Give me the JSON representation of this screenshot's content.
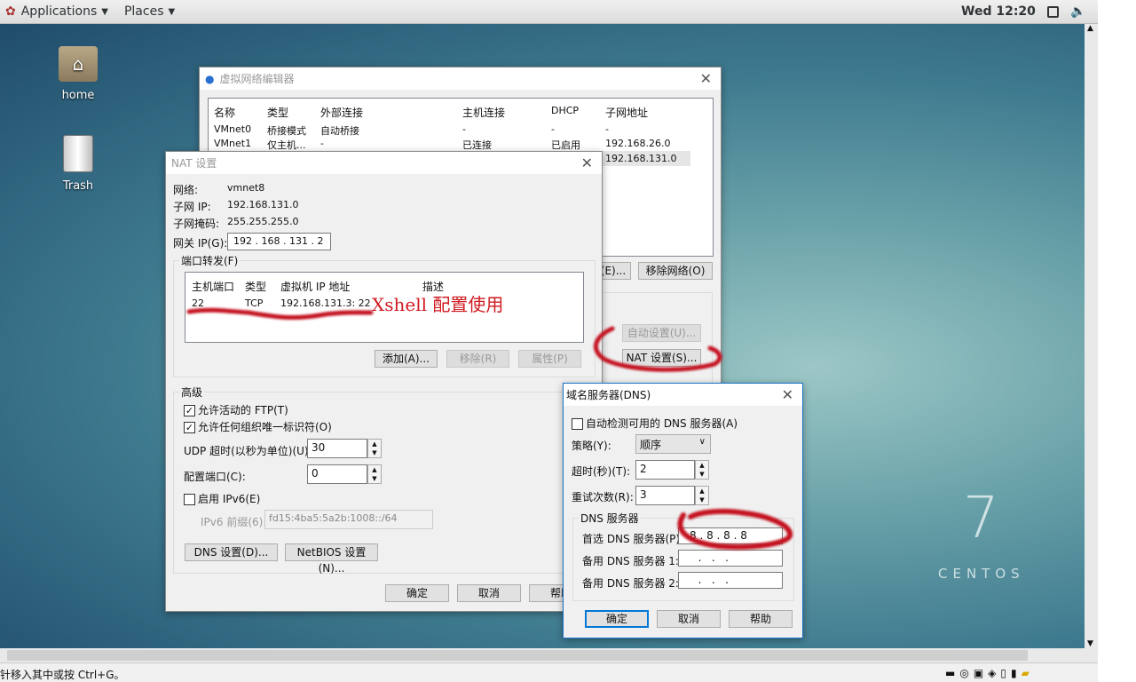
{
  "topbar": {
    "applications": "Applications",
    "places": "Places",
    "clock": "Wed 12:20"
  },
  "desktop": {
    "icons": [
      {
        "label": "home"
      },
      {
        "label": "Trash"
      }
    ],
    "brand_number": "7",
    "brand_text": "CENTOS"
  },
  "status_bar": {
    "text": "针移入其中或按 Ctrl+G。"
  },
  "vne": {
    "title": "虚拟网络编辑器",
    "columns": [
      "名称",
      "类型",
      "外部连接",
      "主机连接",
      "DHCP",
      "子网地址"
    ],
    "rows": [
      [
        "VMnet0",
        "桥接模式",
        "自动桥接",
        "-",
        "-",
        "-"
      ],
      [
        "VMnet1",
        "仅主机...",
        "-",
        "已连接",
        "已启用",
        "192.168.26.0"
      ],
      [
        "",
        "",
        "",
        "",
        "",
        "192.168.131.0"
      ]
    ],
    "btn_rename": "(E)...",
    "btn_remove": "移除网络(O)",
    "btn_auto": "自动设置(U)...",
    "btn_nat": "NAT 设置(S)..."
  },
  "nat": {
    "title": "NAT 设置",
    "network_label": "网络:",
    "network": "vmnet8",
    "subnet_ip_label": "子网 IP:",
    "subnet_ip": "192.168.131.0",
    "mask_label": "子网掩码:",
    "mask": "255.255.255.0",
    "gateway_label": "网关 IP(G):",
    "gateway": "192 . 168 . 131 . 2",
    "pf_group": "端口转发(F)",
    "pf_columns": [
      "主机端口",
      "类型",
      "虚拟机 IP 地址",
      "描述"
    ],
    "pf_rows": [
      [
        "22",
        "TCP",
        "192.168.131.3: 22",
        ""
      ]
    ],
    "annotation": "Xshell 配置使用",
    "btn_add": "添加(A)...",
    "btn_remove": "移除(R)",
    "btn_props": "属性(P)",
    "adv_group": "高级",
    "ftp_label": "允许活动的 FTP(T)",
    "ftp_checked": true,
    "oui_label": "允许任何组织唯一标识符(O)",
    "oui_checked": true,
    "udp_label": "UDP 超时(以秒为单位)(U):",
    "udp": "30",
    "port_label": "配置端口(C):",
    "port": "0",
    "ipv6_label": "启用 IPv6(E)",
    "ipv6_checked": false,
    "prefix_label": "IPv6 前缀(6):",
    "prefix": "fd15:4ba5:5a2b:1008::/64",
    "btn_dns": "DNS 设置(D)...",
    "btn_netbios": "NetBIOS 设置(N)...",
    "btn_ok": "确定",
    "btn_cancel": "取消",
    "btn_help": "帮助"
  },
  "dns": {
    "title": "域名服务器(DNS)",
    "auto_label": "自动检测可用的 DNS 服务器(A)",
    "auto_checked": false,
    "policy_label": "策略(Y):",
    "policy": "顺序",
    "timeout_label": "超时(秒)(T):",
    "timeout": "2",
    "retry_label": "重试次数(R):",
    "retry": "3",
    "group": "DNS 服务器",
    "pref_label": "首选 DNS 服务器(P):",
    "pref": "8 . 8 . 8 . 8",
    "alt1_label": "备用 DNS 服务器 1:",
    "alt1": "  .   .   .",
    "alt2_label": "备用 DNS 服务器 2:",
    "alt2": "  .   .   .",
    "btn_ok": "确定",
    "btn_cancel": "取消",
    "btn_help": "帮助"
  }
}
